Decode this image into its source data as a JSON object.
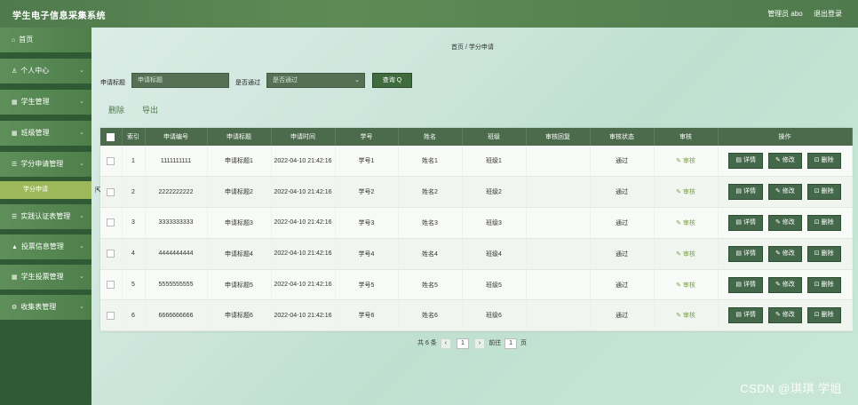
{
  "header": {
    "title": "学生电子信息采集系统",
    "admin": "管理员 abo",
    "logout": "退出登录"
  },
  "sidebar": {
    "items": [
      {
        "icon": "home-icon",
        "glyph": "⌂",
        "label": "首页",
        "has_chevron": false
      },
      {
        "icon": "user-icon",
        "glyph": "♙",
        "label": "个人中心",
        "has_chevron": true
      },
      {
        "icon": "grid-icon",
        "glyph": "▦",
        "label": "学生管理",
        "has_chevron": true
      },
      {
        "icon": "grid-icon",
        "glyph": "▦",
        "label": "班级管理",
        "has_chevron": true
      },
      {
        "icon": "list-icon",
        "glyph": "☰",
        "label": "学分申请管理",
        "has_chevron": true
      },
      {
        "icon": "list-icon",
        "glyph": "☰",
        "label": "实践认证表管理",
        "has_chevron": true
      },
      {
        "icon": "chart-icon",
        "glyph": "▲",
        "label": "投票信息管理",
        "has_chevron": true
      },
      {
        "icon": "grid-icon",
        "glyph": "▦",
        "label": "学生投票管理",
        "has_chevron": true
      },
      {
        "icon": "gear-icon",
        "glyph": "⚙",
        "label": "收集表管理",
        "has_chevron": true
      }
    ],
    "active_sub": "学分申请"
  },
  "breadcrumb": "首页 / 学分申请",
  "search": {
    "title_label": "申请标题",
    "title_placeholder": "申请标题",
    "pass_label": "是否通过",
    "pass_value": "是否通过",
    "query_button": "查询 Q"
  },
  "actions": {
    "delete": "删除",
    "export": "导出"
  },
  "table": {
    "columns": [
      "",
      "索引",
      "申请编号",
      "申请标题",
      "申请时间",
      "学号",
      "姓名",
      "班级",
      "审核回复",
      "审核状态",
      "审核",
      "操作"
    ],
    "audit_label": "✎ 审核",
    "ops": {
      "detail": "▤ 详情",
      "edit": "✎ 修改",
      "delete": "⊡ 删除"
    },
    "rows": [
      {
        "index": "1",
        "code": "1111111111",
        "title": "申请标题1",
        "time": "2022-04-10 21:42:16",
        "sid": "学号1",
        "name": "姓名1",
        "cls": "班级1",
        "reply": "",
        "status": "通过"
      },
      {
        "index": "2",
        "code": "2222222222",
        "title": "申请标题2",
        "time": "2022-04-10 21:42:16",
        "sid": "学号2",
        "name": "姓名2",
        "cls": "班级2",
        "reply": "",
        "status": "通过"
      },
      {
        "index": "3",
        "code": "3333333333",
        "title": "申请标题3",
        "time": "2022-04-10 21:42:16",
        "sid": "学号3",
        "name": "姓名3",
        "cls": "班级3",
        "reply": "",
        "status": "通过"
      },
      {
        "index": "4",
        "code": "4444444444",
        "title": "申请标题4",
        "time": "2022-04-10 21:42:16",
        "sid": "学号4",
        "name": "姓名4",
        "cls": "班级4",
        "reply": "",
        "status": "通过"
      },
      {
        "index": "5",
        "code": "5555555555",
        "title": "申请标题5",
        "time": "2022-04-10 21:42:16",
        "sid": "学号5",
        "name": "姓名5",
        "cls": "班级5",
        "reply": "",
        "status": "通过"
      },
      {
        "index": "6",
        "code": "6666666666",
        "title": "申请标题6",
        "time": "2022-04-10 21:42:16",
        "sid": "学号6",
        "name": "姓名6",
        "cls": "班级6",
        "reply": "",
        "status": "通过"
      }
    ]
  },
  "pager": {
    "total": "共 6 条",
    "prev": "‹",
    "page": "1",
    "next": "›",
    "goto_label": "前往",
    "goto_value": "1",
    "goto_suffix": "页"
  },
  "watermark": "CSDN @琪琪 学姐"
}
